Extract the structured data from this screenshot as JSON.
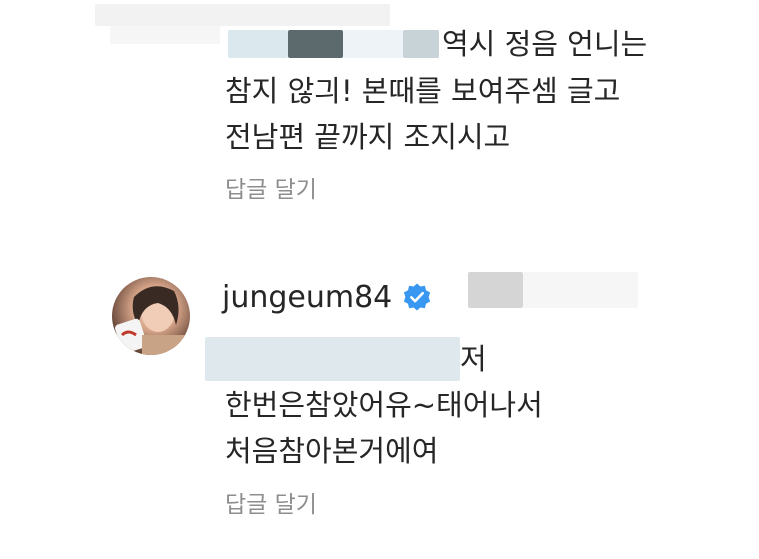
{
  "comment1": {
    "line1": "역시 정음 언니는",
    "line2": "참지 않긔! 본때를 보여주셈 글고",
    "line3": "전남편 끝까지 조지시고",
    "reply_label": "답글 달기"
  },
  "comment2": {
    "username": "jungeum84",
    "verified_icon": "verified-badge-icon",
    "line1": "저",
    "line2": "한번은참았어유~태어나서",
    "line3": "처음참아본거에여",
    "reply_label": "답글 달기"
  },
  "colors": {
    "text": "#262626",
    "secondary_text": "#8e8e8e",
    "verified": "#3897f0",
    "redaction": "#dfe6ea"
  }
}
